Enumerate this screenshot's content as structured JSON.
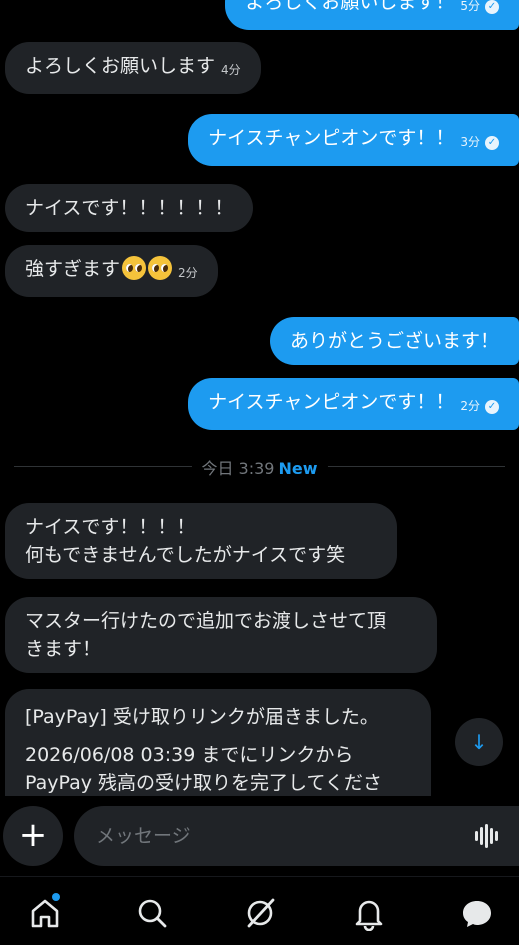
{
  "messages": [
    {
      "direction": "out",
      "text": "よろしくお願いします！",
      "time": "5分",
      "read": true
    },
    {
      "direction": "in",
      "text": "よろしくお願いします",
      "time": "4分"
    },
    {
      "direction": "out",
      "text": "ナイスチャンピオンです！！",
      "time": "3分",
      "read": true
    },
    {
      "direction": "in",
      "text": "ナイスです！！！！！！"
    },
    {
      "direction": "in",
      "text": "強すぎます",
      "emoji": "pleading-face",
      "time": "2分"
    },
    {
      "direction": "out",
      "text": "ありがとうございます！"
    },
    {
      "direction": "out",
      "text": "ナイスチャンピオンです！！",
      "time": "2分",
      "read": true
    }
  ],
  "divider": {
    "label": "今日 3:39",
    "badge": "New"
  },
  "new_messages": [
    {
      "line1": "ナイスです！！！！",
      "line2": "何もできませんでしたがナイスです笑"
    },
    {
      "line1": "マスター行けたので追加でお渡しさせて頂",
      "line2": "きます！"
    },
    {
      "line1": "[PayPay] 受け取りリンクが届きました。",
      "line2": "2026/06/08 03:39 までにリンクから",
      "line3": "PayPay 残高の受け取りを完了してくださ"
    }
  ],
  "composer": {
    "placeholder": "メッセージ"
  },
  "nav": {
    "items": [
      "home",
      "search",
      "grok",
      "notifications",
      "messages"
    ],
    "home_has_dot": true
  },
  "colors": {
    "accent": "#1d9bf0",
    "incoming_bubble": "#202327",
    "background": "#000000"
  }
}
